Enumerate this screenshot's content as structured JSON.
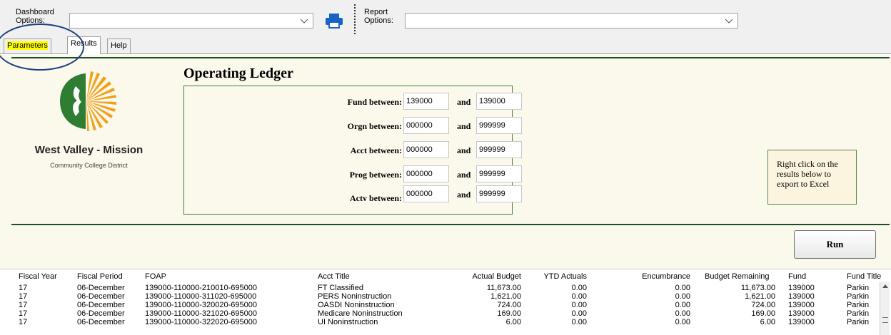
{
  "toolbar": {
    "dashboard_label_1": "Dashboard",
    "dashboard_label_2": "Options:",
    "dashboard_value": "",
    "report_label_1": "Report",
    "report_label_2": "Options:",
    "report_value": ""
  },
  "tabs": [
    {
      "label": "Parameters"
    },
    {
      "label": "Results"
    },
    {
      "label": "Help"
    }
  ],
  "report_title": "Operating Ledger",
  "logo": {
    "org_name": "West Valley - Mission",
    "org_sub": "Community College District"
  },
  "params": [
    {
      "label": "Fund  between:",
      "and": "and",
      "from": "139000",
      "to": "139000"
    },
    {
      "label": "Orgn between:",
      "and": "and",
      "from": "000000",
      "to": "999999"
    },
    {
      "label": "Acct between:",
      "and": "and",
      "from": "000000",
      "to": "999999"
    },
    {
      "label": "Prog between:",
      "and": "and",
      "from": "000000",
      "to": "999999"
    },
    {
      "label": "Actv between:",
      "and": "and",
      "from": "000000",
      "to": "999999"
    }
  ],
  "note": {
    "line1": "Right click on the",
    "line2": "results below to",
    "line3": "export to Excel"
  },
  "run_label": "Run",
  "grid": {
    "headers": [
      "Fiscal Year",
      "Fiscal Period",
      "FOAP",
      "Acct Title",
      "Actual Budget",
      "YTD Actuals",
      "Encumbrance",
      "Budget Remaining",
      "Fund",
      "Fund Title"
    ],
    "rows": [
      [
        "17",
        "06-December",
        "139000-110000-210010-695000",
        "FT Classified",
        "11,673.00",
        "0.00",
        "0.00",
        "11,673.00",
        "139000",
        "Parkin"
      ],
      [
        "17",
        "06-December",
        "139000-110000-311020-695000",
        "PERS Noninstruction",
        "1,621.00",
        "0.00",
        "0.00",
        "1,621.00",
        "139000",
        "Parkin"
      ],
      [
        "17",
        "06-December",
        "139000-110000-320020-695000",
        "OASDI Noninstruction",
        "724.00",
        "0.00",
        "0.00",
        "724.00",
        "139000",
        "Parkin"
      ],
      [
        "17",
        "06-December",
        "139000-110000-321020-695000",
        "Medicare Noninstruction",
        "169.00",
        "0.00",
        "0.00",
        "169.00",
        "139000",
        "Parkin"
      ],
      [
        "17",
        "06-December",
        "139000-110000-322020-695000",
        "UI Noninstruction",
        "6.00",
        "0.00",
        "0.00",
        "6.00",
        "139000",
        "Parkin"
      ]
    ]
  },
  "colors": {
    "accent_green": "#1e4d2b",
    "panel_bg": "#fbf8ec",
    "tab_highlight": "#ffff00",
    "printer_blue": "#1a63c6"
  }
}
